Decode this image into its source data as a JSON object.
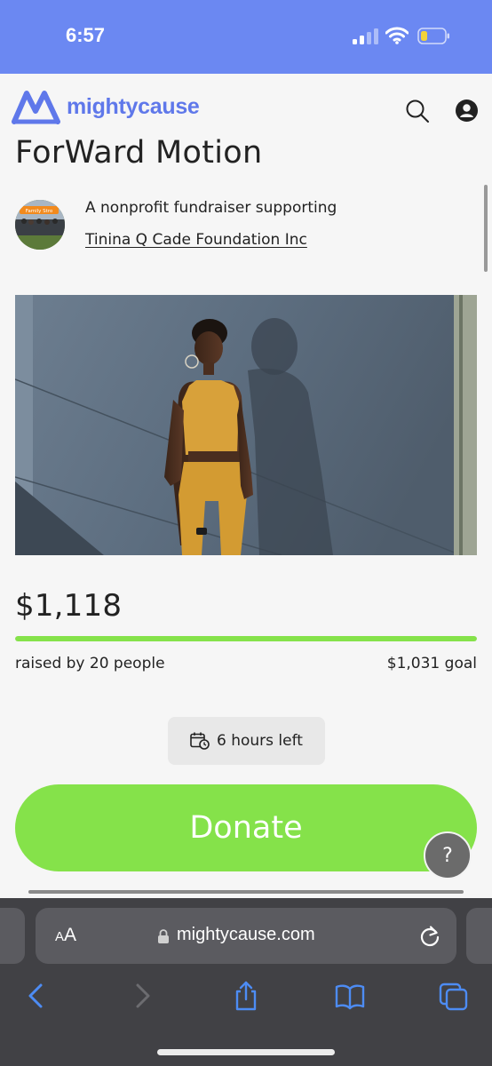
{
  "status_bar": {
    "time": "6:57"
  },
  "header": {
    "logo_text": "mightycause"
  },
  "campaign": {
    "title": "ForWard Motion",
    "supporting_text": "A nonprofit fundraiser supporting",
    "org_name": "Tinina Q Cade Foundation Inc",
    "org_avatar_text": "Family Stro"
  },
  "stats": {
    "amount_raised": "$1,118",
    "raised_by": "raised by 20 people",
    "goal": "$1,031 goal",
    "progress_percent": 100
  },
  "time_left": "6 hours left",
  "donate_label": "Donate",
  "help_label": "?",
  "browser": {
    "aa_small": "A",
    "aa_big": "A",
    "url": "mightycause.com"
  },
  "colors": {
    "status_bar": "#6b88f2",
    "brand_blue": "#5f78ea",
    "accent_green": "#85e24a",
    "browser_chrome": "#414145",
    "toolbar_icon_blue": "#4d8cf4"
  },
  "icons": [
    "signal-icon",
    "wifi-icon",
    "battery-icon",
    "mightycause-logo-icon",
    "search-icon",
    "account-icon",
    "calendar-clock-icon",
    "lock-icon",
    "reload-icon",
    "back-icon",
    "forward-icon",
    "share-icon",
    "bookmarks-icon",
    "tabs-icon"
  ]
}
